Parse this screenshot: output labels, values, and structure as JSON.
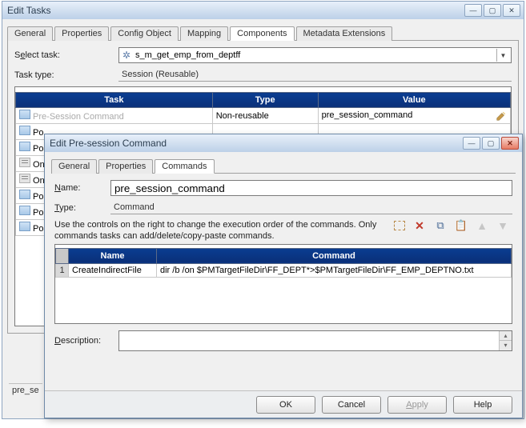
{
  "main_window": {
    "title": "Edit Tasks",
    "tabs": [
      "General",
      "Properties",
      "Config Object",
      "Mapping",
      "Components",
      "Metadata Extensions"
    ],
    "active_tab_index": 4,
    "select_task_label": "Select task:",
    "select_task_value": "s_m_get_emp_from_deptff",
    "task_type_label": "Task type:",
    "task_type_value": "Session (Reusable)",
    "grid_headers": [
      "Task",
      "Type",
      "Value"
    ],
    "grid_rows": [
      {
        "task": "Pre-Session Command",
        "type": "Non-reusable",
        "value": "pre_session_command",
        "disabled_task": true,
        "icon": "task",
        "editable_value": true
      },
      {
        "task": "Po",
        "type": "",
        "value": "",
        "icon": "task"
      },
      {
        "task": "Po",
        "type": "",
        "value": "",
        "icon": "task"
      },
      {
        "task": "On",
        "type": "",
        "value": "",
        "icon": "cmd"
      },
      {
        "task": "On",
        "type": "",
        "value": "",
        "icon": "cmd"
      },
      {
        "task": "Po",
        "type": "",
        "value": "",
        "icon": "task"
      },
      {
        "task": "Po",
        "type": "",
        "value": "",
        "icon": "task"
      },
      {
        "task": "Po",
        "type": "",
        "value": "",
        "icon": "task"
      }
    ],
    "cutoff_label": "pre_se"
  },
  "inner_window": {
    "title": "Edit Pre-session Command",
    "tabs": [
      "General",
      "Properties",
      "Commands"
    ],
    "active_tab_index": 2,
    "name_label": "Name:",
    "name_underline": "N",
    "name_value": "pre_session_command",
    "type_label": "Type:",
    "type_underline": "T",
    "type_value": "Command",
    "instructions": "Use the controls on the right to change the execution order of the commands.  Only commands tasks can add/delete/copy-paste commands.",
    "cmd_headers": [
      "",
      "Name",
      "Command"
    ],
    "cmd_rows": [
      {
        "n": "1",
        "name": "CreateIndirectFile",
        "command": "dir /b /on $PMTargetFileDir\\FF_DEPT*>$PMTargetFileDir\\FF_EMP_DEPTNO.txt"
      }
    ],
    "description_label": "Description:",
    "description_underline": "D",
    "description_value": "",
    "buttons": {
      "ok": "OK",
      "cancel": "Cancel",
      "apply": "Apply",
      "help": "Help"
    }
  }
}
